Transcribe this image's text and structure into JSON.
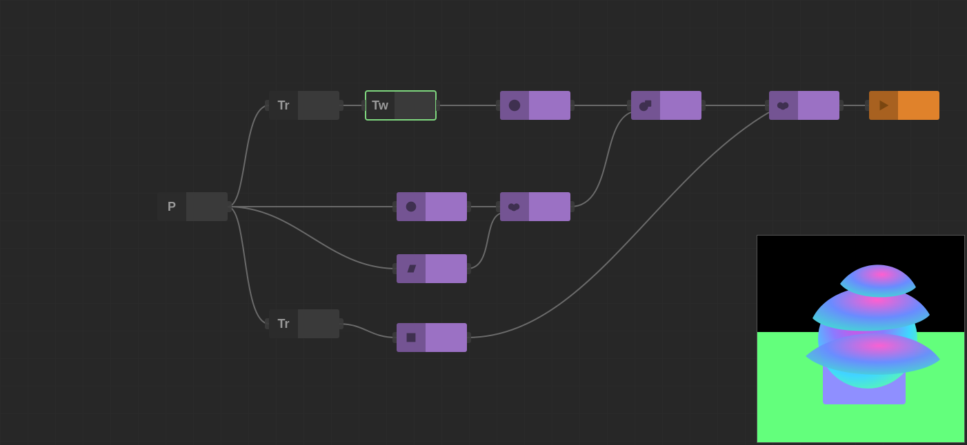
{
  "colors": {
    "bg": "#272727",
    "node_gray": "#3a3a3a",
    "node_purple": "#9b71c4",
    "node_orange": "#e0822b",
    "selected_outline": "#7fd87f",
    "wire": "#6a6a6a"
  },
  "nodes": {
    "p": {
      "label": "P",
      "icon": "text-P",
      "kind": "gray",
      "selected": false
    },
    "tr_top": {
      "label": "Tr",
      "icon": "text-Tr",
      "kind": "gray",
      "selected": false
    },
    "tr_bot": {
      "label": "Tr",
      "icon": "text-Tr",
      "kind": "gray",
      "selected": false
    },
    "tw": {
      "label": "Tw",
      "icon": "text-Tw",
      "kind": "gray",
      "selected": true
    },
    "torus": {
      "label": "",
      "icon": "torus",
      "kind": "purple",
      "selected": false
    },
    "sphere": {
      "label": "",
      "icon": "circle",
      "kind": "purple",
      "selected": false
    },
    "plane": {
      "label": "",
      "icon": "parallelogram",
      "kind": "purple",
      "selected": false
    },
    "box": {
      "label": "",
      "icon": "square",
      "kind": "purple",
      "selected": false
    },
    "smooth1": {
      "label": "",
      "icon": "peanut",
      "kind": "purple",
      "selected": false
    },
    "union": {
      "label": "",
      "icon": "blob",
      "kind": "purple",
      "selected": false
    },
    "smooth2": {
      "label": "",
      "icon": "peanut",
      "kind": "purple",
      "selected": false
    },
    "output": {
      "label": "",
      "icon": "play",
      "kind": "orange",
      "selected": false
    }
  },
  "preview": {
    "visible": true,
    "description": "twisted-torus-sphere-and-box normal-map render on green ground"
  }
}
